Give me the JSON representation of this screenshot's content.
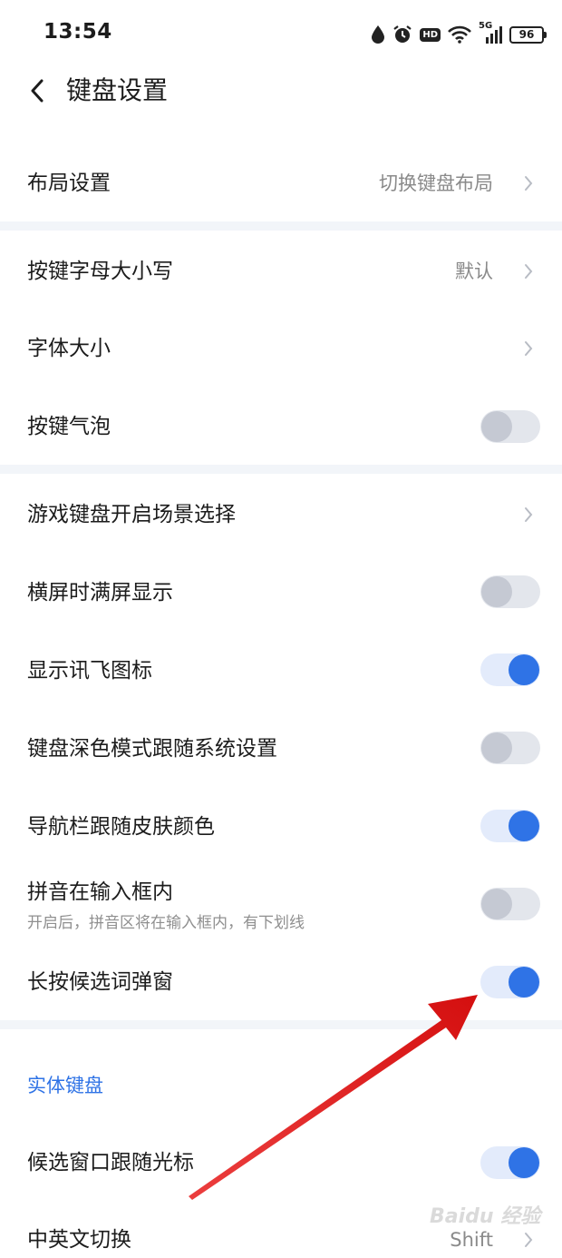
{
  "status_bar": {
    "time": "13:54",
    "battery": "96",
    "hd": "HD",
    "network": "5G",
    "icons": [
      "water-drop-icon",
      "alarm-icon",
      "hd-icon",
      "wifi-icon",
      "signal-5g-icon",
      "battery-icon"
    ]
  },
  "header": {
    "title": "键盘设置",
    "back_icon": "back-arrow-icon"
  },
  "rows": {
    "layout": {
      "label": "布局设置",
      "value": "切换键盘布局"
    },
    "key_case": {
      "label": "按键字母大小写",
      "value": "默认"
    },
    "font_size": {
      "label": "字体大小"
    },
    "key_bubble": {
      "label": "按键气泡",
      "on": false
    },
    "game_keyboard": {
      "label": "游戏键盘开启场景选择"
    },
    "landscape_full": {
      "label": "横屏时满屏显示",
      "on": false
    },
    "show_icon": {
      "label": "显示讯飞图标",
      "on": true
    },
    "dark_mode": {
      "label": "键盘深色模式跟随系统设置",
      "on": false
    },
    "navbar_color": {
      "label": "导航栏跟随皮肤颜色",
      "on": true
    },
    "pinyin_inline": {
      "label": "拼音在输入框内",
      "sub": "开启后，拼音区将在输入框内，有下划线",
      "on": false
    },
    "long_press_popup": {
      "label": "长按候选词弹窗",
      "on": true
    },
    "candidate_follow": {
      "label": "候选窗口跟随光标",
      "on": true
    },
    "cn_en_switch": {
      "label": "中英文切换",
      "value": "Shift"
    }
  },
  "sections": {
    "physical_keyboard": "实体键盘"
  },
  "colors": {
    "accent": "#2f73e6",
    "annotation_arrow": "#e81c1c",
    "divider": "#f2f5f9"
  },
  "watermark": "Baidu 经验"
}
